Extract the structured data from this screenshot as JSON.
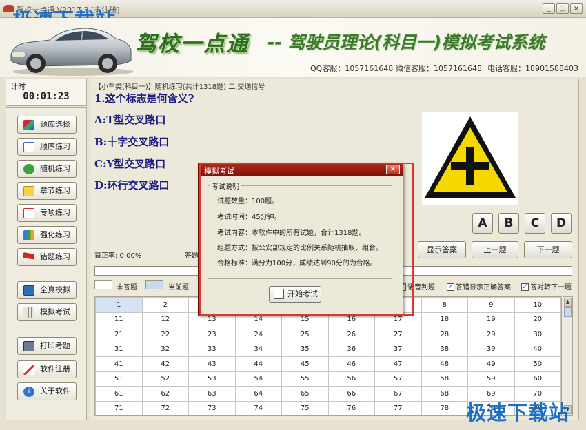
{
  "window": {
    "title": "驾校一点通 V2017.3 [未注册]"
  },
  "watermark": {
    "top_left": "极速下载站",
    "bottom_right": "极速下载站"
  },
  "header": {
    "brand": "驾校一点通",
    "subtitle": "-- 驾驶员理论(科目一)模拟考试系统",
    "contacts": [
      {
        "label": "QQ客服：1057161648"
      },
      {
        "label": "微信客服：1057161648"
      },
      {
        "label": "电话客服：18901588403"
      }
    ]
  },
  "timer": {
    "label": "计时",
    "value": "00:01:23"
  },
  "sidebar": {
    "items": [
      {
        "label": "题库选择"
      },
      {
        "label": "顺序练习"
      },
      {
        "label": "随机练习"
      },
      {
        "label": "章节练习"
      },
      {
        "label": "专项练习"
      },
      {
        "label": "强化练习"
      },
      {
        "label": "错题练习"
      },
      {
        "label": "全真模拟"
      },
      {
        "label": "模拟考试"
      },
      {
        "label": "打印考题"
      },
      {
        "label": "软件注册"
      },
      {
        "label": "关于软件"
      }
    ]
  },
  "question": {
    "header": "【小车类(科目一)】随机练习(共计1318题) 二.交通信号",
    "text": "1.这个标志是何含义?",
    "options": [
      "A:T型交叉路口",
      "B:十字交叉路口",
      "C:Y型交叉路口",
      "D:环行交叉路口"
    ]
  },
  "answers": {
    "buttons": [
      "A",
      "B",
      "C",
      "D"
    ]
  },
  "status": {
    "correct_rate": "首正率: 0.00%",
    "answer_label": "答题"
  },
  "controls": {
    "show_answer": "显示答案",
    "prev": "上一题",
    "next": "下一题"
  },
  "legend": {
    "unanswered": "未答题",
    "current": "当前题"
  },
  "options_checkboxes": {
    "voice": "语音判题",
    "show_correct": "答错显示正确答案",
    "auto_next": "答对转下一题"
  },
  "grid": {
    "rows": [
      [
        "1",
        "2",
        "3",
        "4",
        "5",
        "6",
        "7",
        "8",
        "9",
        "10"
      ],
      [
        "11",
        "12",
        "13",
        "14",
        "15",
        "16",
        "17",
        "18",
        "19",
        "20"
      ],
      [
        "21",
        "22",
        "23",
        "24",
        "25",
        "26",
        "27",
        "28",
        "29",
        "30"
      ],
      [
        "31",
        "32",
        "33",
        "34",
        "35",
        "36",
        "37",
        "38",
        "39",
        "40"
      ],
      [
        "41",
        "42",
        "43",
        "44",
        "45",
        "46",
        "47",
        "48",
        "49",
        "50"
      ],
      [
        "51",
        "52",
        "53",
        "54",
        "55",
        "56",
        "57",
        "58",
        "59",
        "60"
      ],
      [
        "61",
        "62",
        "63",
        "64",
        "65",
        "66",
        "67",
        "68",
        "69",
        "70"
      ],
      [
        "71",
        "72",
        "73",
        "74",
        "75",
        "76",
        "77",
        "78",
        "79",
        "80"
      ]
    ]
  },
  "dialog": {
    "title": "模拟考试",
    "close": "×",
    "group_title": "考试说明",
    "lines": [
      "试题数量：100题。",
      "考试时间：45分钟。",
      "考试内容：本软件中的所有试题，合计1318题。",
      "组题方式：按公安部规定的比例关系随机抽取、组合。",
      "合格标准：满分为100分，成绩达到90分的为合格。"
    ],
    "start_button": "开始考试"
  },
  "colors": {
    "accent_red": "#e0352b",
    "title_red": "#9b1a10",
    "brand_green": "#2f6e1d",
    "question_blue": "#1a1a80",
    "sign_yellow": "#f5d800"
  }
}
